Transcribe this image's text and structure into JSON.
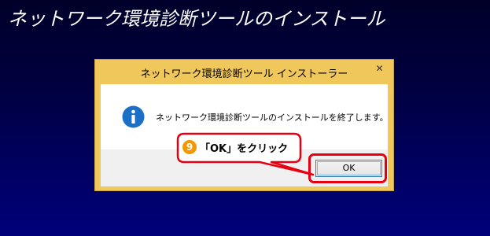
{
  "page": {
    "title": "ネットワーク環境診断ツールのインストール"
  },
  "dialog": {
    "title": "ネットワーク環境診断ツール インストーラー",
    "close_glyph": "✕",
    "message": "ネットワーク環境診断ツールのインストールを終了します。",
    "icon": "info-icon",
    "ok_label": "OK"
  },
  "callout": {
    "step_number": "9",
    "text": "「OK」をクリック",
    "accent_color": "#e60012",
    "number_color": "#f39800"
  }
}
